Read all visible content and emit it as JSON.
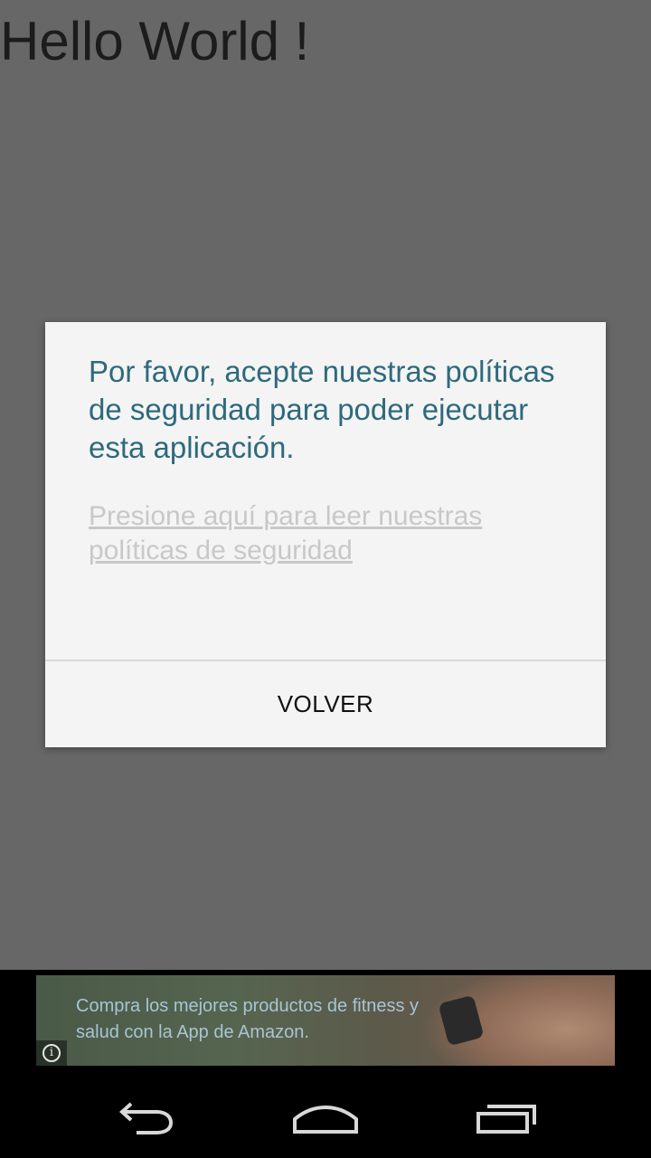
{
  "app": {
    "hello_text": "Hello World !"
  },
  "dialog": {
    "message": "Por favor, acepte nuestras políticas de seguridad para poder ejecutar esta aplicación.",
    "link": "Presione aquí para leer nuestras políticas de seguridad",
    "button_label": "VOLVER"
  },
  "ad": {
    "text": "Compra los mejores productos de fitness y salud con la App de Amazon.",
    "info_icon": "info-icon"
  },
  "navbar": {
    "back_icon": "back-icon",
    "home_icon": "home-icon",
    "recents_icon": "recents-icon"
  },
  "colors": {
    "dim_background": "#676767",
    "dialog_background": "#f4f4f4",
    "message_color": "#2e6a7c",
    "link_color": "#c8c8c8"
  }
}
